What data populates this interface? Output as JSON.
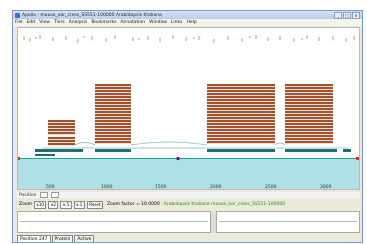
{
  "window": {
    "title": "Apollo - mouse_ear_cress_SS551-100000 Arabidopsis thaliana",
    "controls": [
      "_",
      "□",
      "×"
    ]
  },
  "menu": [
    "File",
    "Edit",
    "View",
    "Tiers",
    "Analysis",
    "Bookmarks",
    "Annotation",
    "Window",
    "Links",
    "Help"
  ],
  "axis_bar": {
    "label": "Position"
  },
  "ruler": {
    "ticks": [
      "500",
      "1000",
      "1500",
      "2000",
      "2500",
      "3000"
    ]
  },
  "toolbar": {
    "zoom_label": "Zoom",
    "buttons": [
      "x10",
      "x2",
      "x.5",
      "x.1",
      "Reset"
    ],
    "zoom_factor": "Zoom factor = 10.0000",
    "species": "Arabidopsis thaliana mouse_ear_cress_SS551-100000"
  },
  "tabs": [
    "Position 247",
    "Protein",
    "Active"
  ],
  "colors": {
    "feature_brown": "#a0522d",
    "gene_teal": "#1f6f6f",
    "strand_cyan": "#aee0e6",
    "strand_line": "#00aaaa",
    "marker_purple": "#800080"
  }
}
